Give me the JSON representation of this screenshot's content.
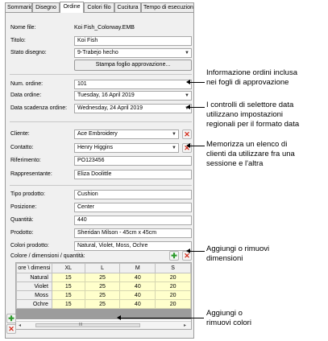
{
  "tabs": [
    "Sommario",
    "Disegno",
    "Ordine",
    "Colori filo",
    "Cucitura",
    "Tempo di esecuzione"
  ],
  "active_tab": "Ordine",
  "design": {
    "file_label": "Nome file:",
    "file_value": "Koi Fish_Colorway.EMB",
    "title_label": "Titolo:",
    "title_value": "Koi Fish",
    "status_label": "Stato disegno:",
    "status_value": "9-Trabejo hecho",
    "print_button": "Stampa foglio approvazione..."
  },
  "order": {
    "number_label": "Num. ordine:",
    "number_value": "101",
    "date_label": "Data ordine:",
    "date_value": "Tuesday, 16 April 2019",
    "due_label": "Data scadenza ordine:",
    "due_value": "Wednesday, 24 April 2019"
  },
  "customer": {
    "client_label": "Cliente:",
    "client_value": "Ace Embroidery",
    "contact_label": "Contatto:",
    "contact_value": "Henry Higgins",
    "reference_label": "Riferimento:",
    "reference_value": "PO123456",
    "rep_label": "Rappresentante:",
    "rep_value": "Eliza Doolittle"
  },
  "product": {
    "type_label": "Tipo prodotto:",
    "type_value": "Cushion",
    "position_label": "Posizione:",
    "position_value": "Center",
    "quantity_label": "Quantità:",
    "quantity_value": "440",
    "product_label": "Prodotto:",
    "product_value": "Sheridan Milson - 45cm x 45cm",
    "colors_label": "Colori prodotto:",
    "colors_value": "Natural, Violet, Moss, Ochre",
    "grid_label": "Colore / dimensioni / quantità:"
  },
  "grid": {
    "corner": "ore \\ dimensi",
    "columns": [
      "XL",
      "L",
      "M",
      "S"
    ],
    "rows": [
      {
        "name": "Natural",
        "values": [
          "15",
          "25",
          "40",
          "20"
        ]
      },
      {
        "name": "Violet",
        "values": [
          "15",
          "25",
          "40",
          "20"
        ]
      },
      {
        "name": "Moss",
        "values": [
          "15",
          "25",
          "40",
          "20"
        ]
      },
      {
        "name": "Ochre",
        "values": [
          "15",
          "25",
          "40",
          "20"
        ]
      }
    ],
    "scroll_grip": "III"
  },
  "callouts": {
    "order_info": [
      "Informazione ordini inclusa",
      "nei fogli di approvazione"
    ],
    "date_pickers": [
      "I controlli di selettore data",
      "utilizzano impostazioni",
      "regionali per il formato data"
    ],
    "clients": [
      "Memorizza un elenco di",
      "clienti da utilizzare fra una",
      "sessione e l'altra"
    ],
    "dimensions": [
      "Aggiungi o rimuovi",
      "dimensioni"
    ],
    "colors": [
      "Aggiungi o",
      "rimuovi colori"
    ]
  },
  "icons": {
    "combo_arrow": "chevron-down-icon",
    "remove": "red-x-icon",
    "add": "green-plus-icon"
  },
  "colors": {
    "grid_cell": "#ffffcc",
    "remove": "#d42e1c",
    "add": "#2d9b2d"
  }
}
